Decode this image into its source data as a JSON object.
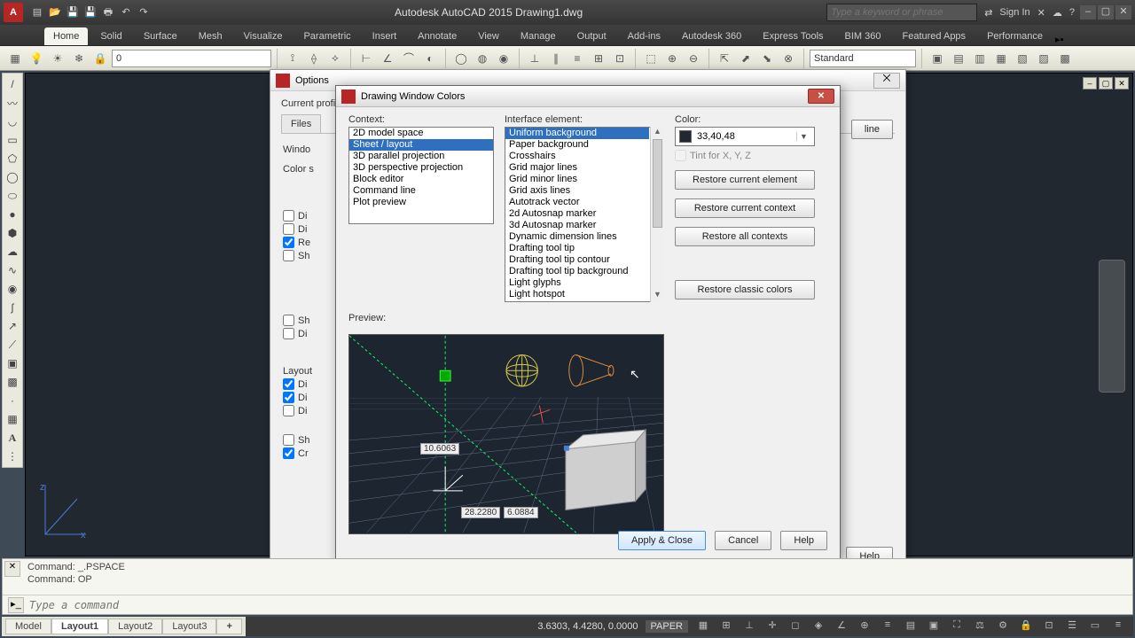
{
  "app": {
    "title": "Autodesk AutoCAD 2015    Drawing1.dwg",
    "search_placeholder": "Type a keyword or phrase",
    "signin": "Sign In"
  },
  "ribbon": {
    "tabs": [
      "Home",
      "Solid",
      "Surface",
      "Mesh",
      "Visualize",
      "Parametric",
      "Insert",
      "Annotate",
      "View",
      "Manage",
      "Output",
      "Add-ins",
      "Autodesk 360",
      "Express Tools",
      "BIM 360",
      "Featured Apps",
      "Performance"
    ],
    "active": 0,
    "layer_combo": "0",
    "style_combo": "Standard"
  },
  "options_dialog": {
    "title": "Options",
    "current_profile": "Current profile:",
    "tabs_visible": "Files",
    "left_labels": {
      "window": "Windo",
      "color": "Color s",
      "layout": "Layout"
    },
    "checks": {
      "di1": "Di",
      "di2": "Di",
      "re": "Re",
      "sh1": "Sh",
      "sh2": "Sh",
      "di3": "Di",
      "di4": "Di",
      "di5": "Di",
      "di6": "Di",
      "sh3": "Sh",
      "cr": "Cr"
    },
    "line_btn": "line",
    "help_btn": "Help"
  },
  "dwc": {
    "title": "Drawing Window Colors",
    "context_label": "Context:",
    "interface_label": "Interface element:",
    "color_label": "Color:",
    "color_value": "33,40,48",
    "tint_label": "Tint for X, Y, Z",
    "context_items": [
      "2D model space",
      "Sheet / layout",
      "3D parallel projection",
      "3D perspective projection",
      "Block editor",
      "Command line",
      "Plot preview"
    ],
    "context_selected": 1,
    "interface_items": [
      "Uniform background",
      "Paper background",
      "Crosshairs",
      "Grid major lines",
      "Grid minor lines",
      "Grid axis lines",
      "Autotrack vector",
      "2d Autosnap marker",
      "3d Autosnap marker",
      "Dynamic dimension lines",
      "Drafting tool tip",
      "Drafting tool tip contour",
      "Drafting tool tip background",
      "Light glyphs",
      "Light hotspot"
    ],
    "interface_selected": 0,
    "btn_restore_elem": "Restore current element",
    "btn_restore_ctx": "Restore current context",
    "btn_restore_all": "Restore all contexts",
    "btn_restore_classic": "Restore classic colors",
    "preview_label": "Preview:",
    "dims": {
      "a": "10.6063",
      "b": "28.2280",
      "c": "6.0884"
    },
    "apply_close": "Apply & Close",
    "cancel": "Cancel",
    "help": "Help"
  },
  "cmd": {
    "hist1": "Command: _.PSPACE",
    "hist2": "Command: OP",
    "placeholder": "Type a command"
  },
  "tabs": {
    "items": [
      "Model",
      "Layout1",
      "Layout2",
      "Layout3"
    ],
    "active": 1,
    "plus": "+"
  },
  "status": {
    "coords": "3.6303, 4.4280, 0.0000",
    "space": "PAPER"
  }
}
